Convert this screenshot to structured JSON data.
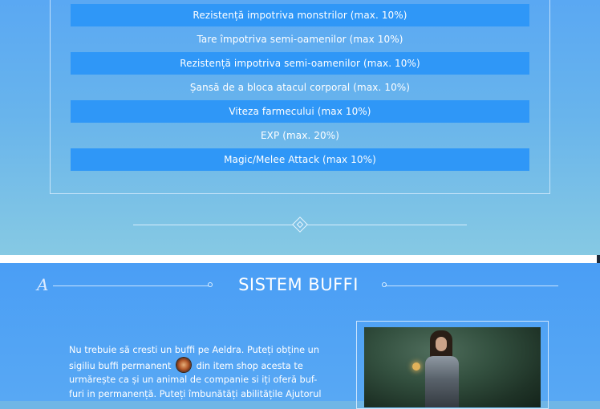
{
  "stats": {
    "rows": [
      {
        "label": "Rezistență impotriva monstrilor (max. 10%)",
        "highlight": true
      },
      {
        "label": "Tare împotriva semi-oamenilor (max 10%)",
        "highlight": false
      },
      {
        "label": "Rezistență impotriva semi-oamenilor (max. 10%)",
        "highlight": true
      },
      {
        "label": "Șansă de a bloca atacul corporal (max. 10%)",
        "highlight": false
      },
      {
        "label": "Viteza farmecului (max 10%)",
        "highlight": true
      },
      {
        "label": "EXP (max. 20%)",
        "highlight": false
      },
      {
        "label": "Magic/Melee Attack (max 10%)",
        "highlight": true
      }
    ],
    "highlight_color": "#2f97f7"
  },
  "section": {
    "title": "SISTEM BUFFI",
    "decor_letter": "A",
    "description_before_icon": "Nu trebuie să cresti un buffi pe Aeldra. Puteți obține un sigiliu buffi permanent",
    "description_after_icon": "din item shop acesta te urmărește ca și un animal de companie si iți oferă buf-furi in permanență. Puteți îmbunătăți abilitățile Ajutorul",
    "icon": "buffi-seal-icon"
  },
  "colors": {
    "top_background": "#68b4ec",
    "bottom_background": "#4a9ef5",
    "text": "#ffffff"
  }
}
